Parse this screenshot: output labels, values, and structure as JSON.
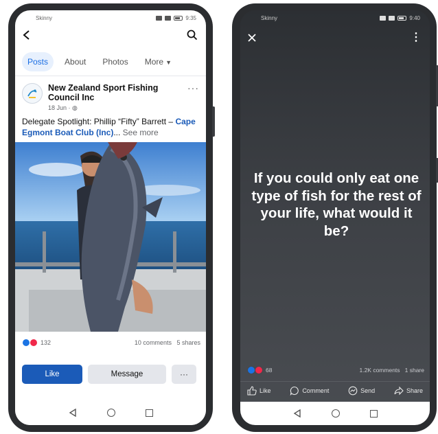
{
  "phone1": {
    "status": {
      "carrier": "Skinny",
      "time": "9:35"
    },
    "header": {
      "back_icon": "back-arrow-icon",
      "search_icon": "search-icon"
    },
    "tabs": [
      {
        "label": "Posts",
        "active": true
      },
      {
        "label": "About",
        "active": false
      },
      {
        "label": "Photos",
        "active": false
      },
      {
        "label": "More",
        "active": false
      }
    ],
    "post": {
      "page_name": "New Zealand Sport Fishing Council Inc",
      "date": "18 Jun · ",
      "text_prefix": "Delegate Spotlight: Phillip “Fifty” Barrett – ",
      "text_link": "Cape Egmont Boat Club (Inc)",
      "text_ellipsis": "...",
      "see_more": " See more",
      "reaction_count": "132",
      "comments": "10 comments",
      "shares": "5 shares"
    },
    "actions": {
      "like": "Like",
      "message": "Message",
      "more": "···"
    }
  },
  "phone2": {
    "status": {
      "carrier": "Skinny",
      "time": "9:40"
    },
    "story": {
      "text": "If you could only eat one type of fish for the rest of your life, what would it be?",
      "reaction_count": "68",
      "comments": "1.2K comments",
      "shares": "1 share"
    },
    "actions": {
      "like": "Like",
      "comment": "Comment",
      "send": "Send",
      "share": "Share"
    }
  },
  "colors": {
    "fb_blue": "#1b5bb8",
    "tab_active_bg": "#e7f0fd",
    "love_red": "#f0284a"
  }
}
